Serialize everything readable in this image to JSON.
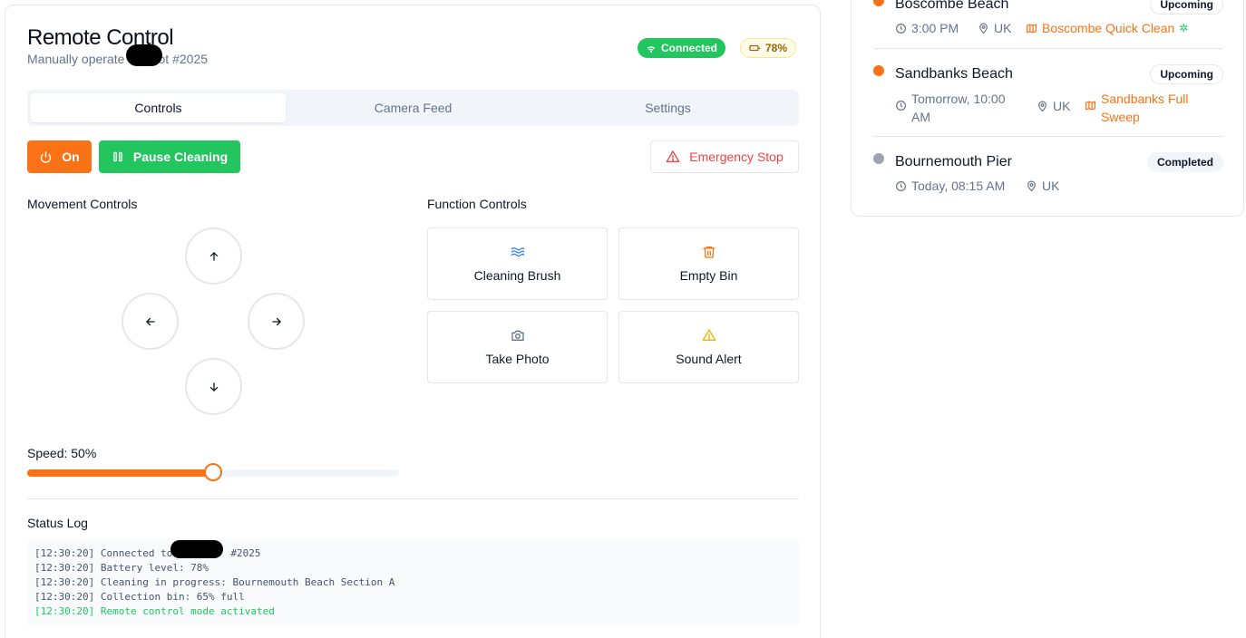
{
  "header": {
    "title": "Remote Control",
    "subtitle_prefix": "Manually operate",
    "subtitle_suffix": "Bot #2025",
    "connection": "Connected",
    "battery": "78%"
  },
  "tabs": [
    {
      "label": "Controls",
      "active": true
    },
    {
      "label": "Camera Feed",
      "active": false
    },
    {
      "label": "Settings",
      "active": false
    }
  ],
  "actions": {
    "power_label": "On",
    "pause_label": "Pause Cleaning",
    "emergency_label": "Emergency Stop"
  },
  "movement": {
    "label": "Movement Controls",
    "speed_label": "Speed: 50%",
    "speed_value": 0.5
  },
  "functions": {
    "label": "Function Controls",
    "items": [
      {
        "label": "Cleaning Brush",
        "icon": "waves-icon",
        "color": "#3b82f6"
      },
      {
        "label": "Empty Bin",
        "icon": "trash-icon",
        "color": "#f97316"
      },
      {
        "label": "Take Photo",
        "icon": "camera-icon",
        "color": "#64748b"
      },
      {
        "label": "Sound Alert",
        "icon": "alert-triangle-icon",
        "color": "#eab308"
      }
    ]
  },
  "status_log": {
    "label": "Status Log",
    "lines": [
      {
        "pre": "[12:30:20] Connected to",
        "post": "#2025"
      },
      {
        "text": "[12:30:20] Battery level: 78%"
      },
      {
        "text": "[12:30:20] Cleaning in progress: Bournemouth Beach Section A"
      },
      {
        "text": "[12:30:20] Collection bin: 65% full"
      },
      {
        "text": "[12:30:20] Remote control mode activated"
      }
    ]
  },
  "schedule": [
    {
      "name": "Boscombe Beach",
      "status": "Upcoming",
      "time": "3:00 PM",
      "location": "UK",
      "route": "Boscombe Quick Clean",
      "dot_color": "#f97316"
    },
    {
      "name": "Sandbanks Beach",
      "status": "Upcoming",
      "time_line1": "Tomorrow, 10:00",
      "time_line2": "AM",
      "location": "UK",
      "route_line1": "Sandbanks Full",
      "route_line2": "Sweep",
      "dot_color": "#f97316"
    },
    {
      "name": "Bournemouth Pier",
      "status": "Completed",
      "time": "Today, 08:15 AM",
      "location": "UK",
      "dot_color": "#9ca3af"
    }
  ],
  "colors": {
    "accent": "#f97316",
    "success": "#22c55e",
    "danger": "#ef4444"
  }
}
